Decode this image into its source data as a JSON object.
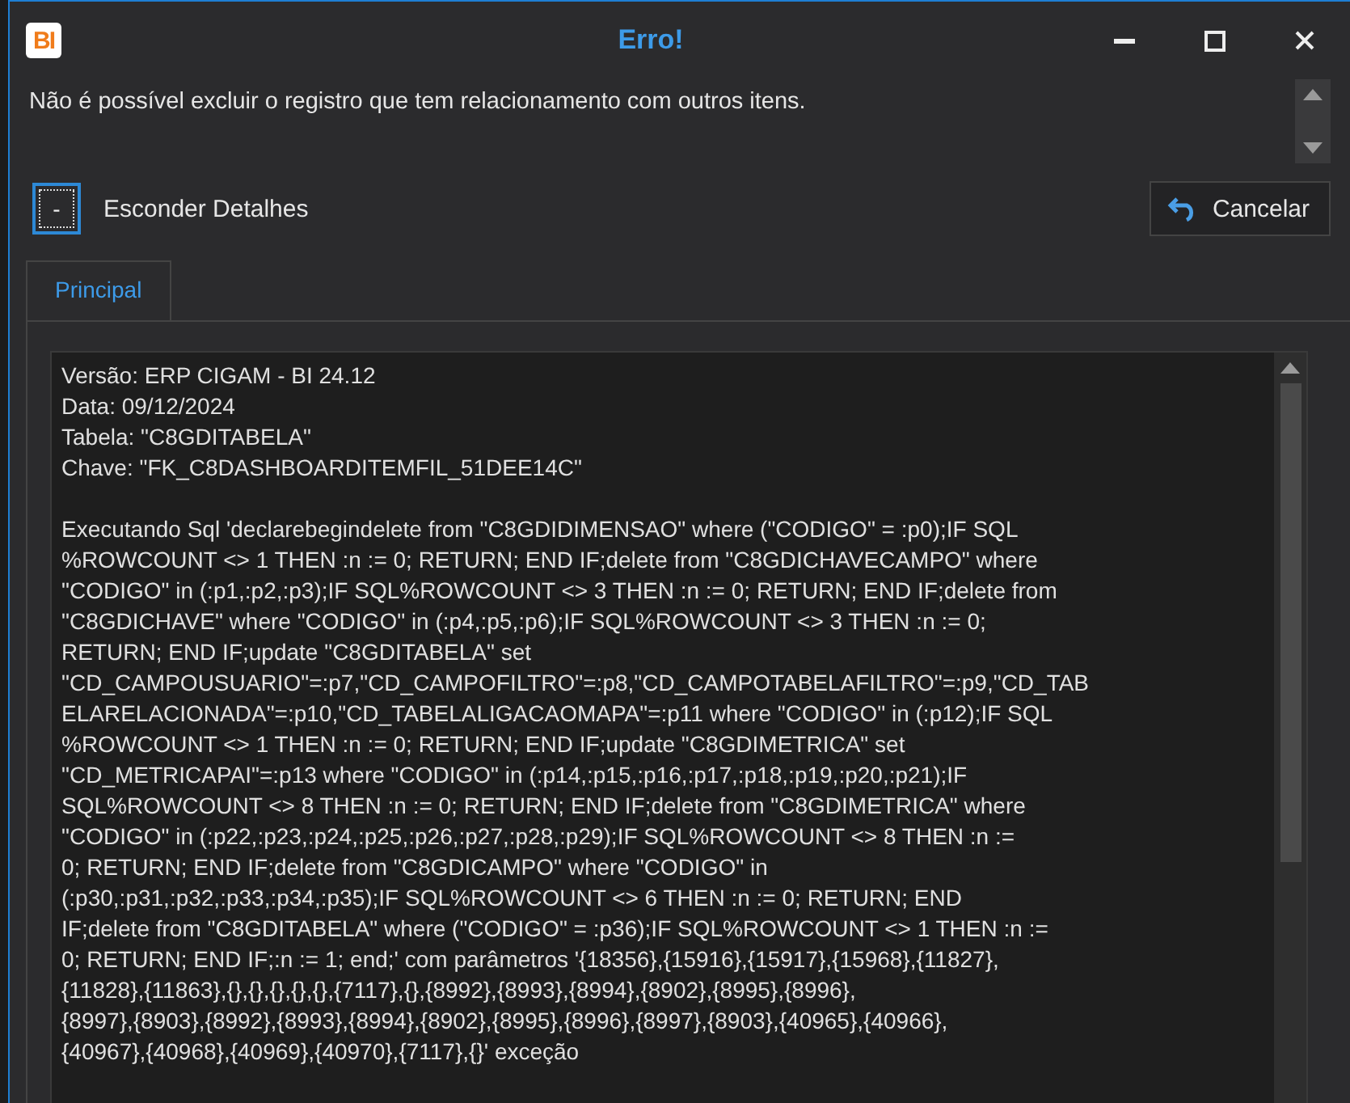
{
  "window": {
    "title": "Erro!",
    "logo": "BI"
  },
  "message": "Não é possível excluir o registro que tem relacionamento com outros itens.",
  "details_toggle": {
    "symbol": "-",
    "label": "Esconder Detalhes",
    "expanded": true
  },
  "cancel_button": {
    "label": "Cancelar"
  },
  "tabs": [
    {
      "label": "Principal",
      "selected": true
    }
  ],
  "details": {
    "header_lines": [
      "Versão: ERP CIGAM - BI 24.12",
      "Data: 09/12/2024",
      "Tabela: \"C8GDITABELA\"",
      "Chave: \"FK_C8DASHBOARDITEMFIL_51DEE14C\""
    ],
    "sql_lines": [
      "Executando Sql 'declarebegindelete from \"C8GDIDIMENSAO\" where (\"CODIGO\" = :p0);IF SQL",
      "%ROWCOUNT <> 1 THEN :n := 0; RETURN; END IF;delete from \"C8GDICHAVECAMPO\" where",
      "\"CODIGO\" in (:p1,:p2,:p3);IF SQL%ROWCOUNT <> 3 THEN :n := 0; RETURN; END IF;delete from",
      "\"C8GDICHAVE\" where \"CODIGO\" in (:p4,:p5,:p6);IF SQL%ROWCOUNT <> 3 THEN :n := 0;",
      "RETURN; END IF;update \"C8GDITABELA\" set",
      "\"CD_CAMPOUSUARIO\"=:p7,\"CD_CAMPOFILTRO\"=:p8,\"CD_CAMPOTABELAFILTRO\"=:p9,\"CD_TAB",
      "ELARELACIONADA\"=:p10,\"CD_TABELALIGACAOMAPA\"=:p11 where \"CODIGO\" in (:p12);IF SQL",
      "%ROWCOUNT <> 1 THEN :n := 0; RETURN; END IF;update \"C8GDIMETRICA\" set",
      "\"CD_METRICAPAI\"=:p13 where \"CODIGO\" in (:p14,:p15,:p16,:p17,:p18,:p19,:p20,:p21);IF",
      "SQL%ROWCOUNT <> 8 THEN :n := 0; RETURN; END IF;delete from \"C8GDIMETRICA\" where",
      "\"CODIGO\" in (:p22,:p23,:p24,:p25,:p26,:p27,:p28,:p29);IF SQL%ROWCOUNT <> 8 THEN :n :=",
      "0; RETURN; END IF;delete from \"C8GDICAMPO\" where \"CODIGO\" in",
      "(:p30,:p31,:p32,:p33,:p34,:p35);IF SQL%ROWCOUNT <> 6 THEN :n := 0; RETURN; END",
      "IF;delete from \"C8GDITABELA\" where (\"CODIGO\" = :p36);IF SQL%ROWCOUNT <> 1 THEN :n :=",
      "0; RETURN; END IF;:n := 1; end;' com parâmetros '{18356},{15916},{15917},{15968},{11827},",
      "{11828},{11863},{},{},{},{},{},{7117},{},{8992},{8993},{8994},{8902},{8995},{8996},",
      "{8997},{8903},{8992},{8993},{8994},{8902},{8995},{8996},{8997},{8903},{40965},{40966},",
      "{40967},{40968},{40969},{40970},{7117},{}' exceção"
    ]
  }
}
